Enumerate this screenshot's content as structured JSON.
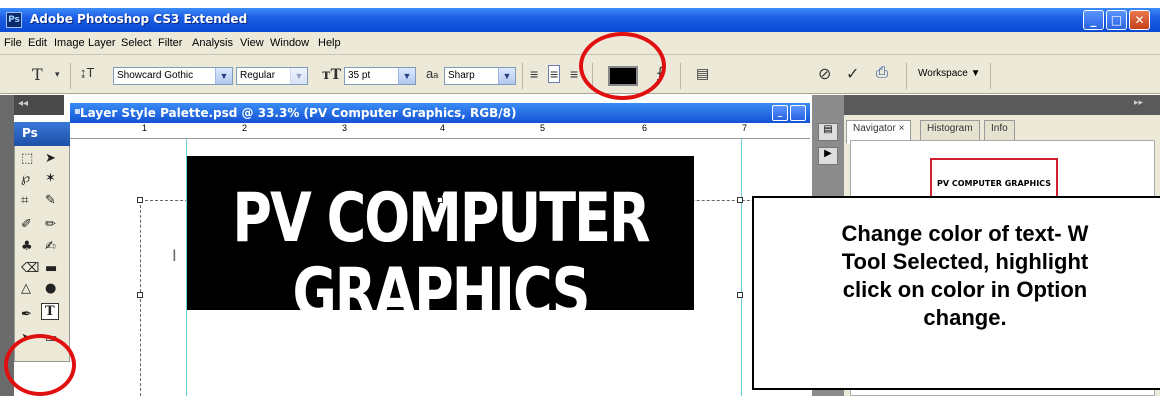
{
  "window": {
    "app_icon": "Ps",
    "title": "Adobe Photoshop CS3 Extended",
    "controls": [
      "_",
      "□",
      "✕"
    ]
  },
  "menu": [
    "File",
    "Edit",
    "Image",
    "Layer",
    "Select",
    "Filter",
    "Analysis",
    "View",
    "Window",
    "Help"
  ],
  "options": {
    "font_family": "Showcard Gothic",
    "font_style": "Regular",
    "font_size": "35 pt",
    "antialias_label": "a",
    "antialias_sub": "a",
    "antialias": "Sharp",
    "text_color": "#000000",
    "workspace_label": "Workspace ▼"
  },
  "toolbox": {
    "logo": "Ps"
  },
  "document": {
    "title": "Layer Style Palette.psd @ 33.3% (PV Computer Graphics, RGB/8)",
    "ruler_numbers": [
      "1",
      "2",
      "3",
      "4",
      "5",
      "6",
      "7"
    ],
    "canvas_text": "PV COMPUTER GRAPHICS"
  },
  "panel": {
    "tabs": [
      "Navigator ×",
      "Histogram",
      "Info"
    ],
    "thumbnail_text": "PV COMPUTER GRAPHICS"
  },
  "annotation": {
    "text": "Change color of text- W\nTool Selected, highlight\nclick on color in Option\nchange."
  },
  "colors": {
    "highlight": "#e01010",
    "titlebar": "#1c5ee6"
  }
}
